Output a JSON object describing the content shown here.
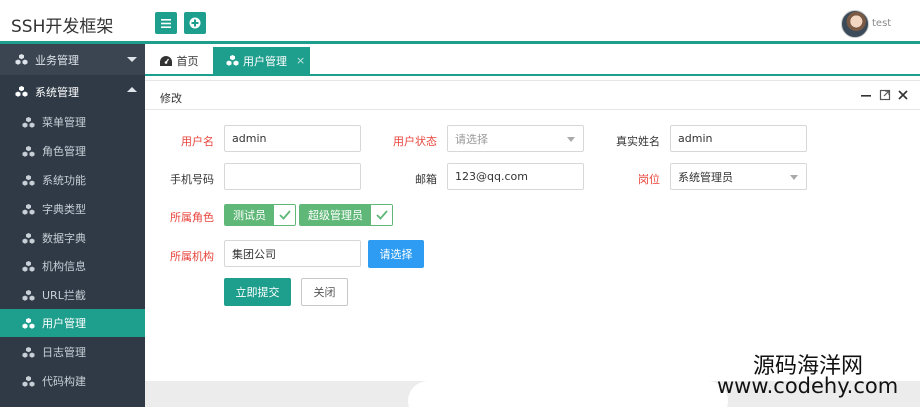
{
  "app": {
    "title": "SSH开发框架",
    "user": "test"
  },
  "header": {
    "menu_icon": "menu-icon",
    "add_icon": "plus-circle-icon"
  },
  "sidebar": {
    "groups": [
      {
        "label": "业务管理",
        "icon": "cubes-icon",
        "expanded": false
      },
      {
        "label": "系统管理",
        "icon": "cubes-icon",
        "expanded": true
      }
    ],
    "items": [
      {
        "label": "菜单管理"
      },
      {
        "label": "角色管理"
      },
      {
        "label": "系统功能"
      },
      {
        "label": "字典类型"
      },
      {
        "label": "数据字典"
      },
      {
        "label": "机构信息"
      },
      {
        "label": "URL拦截"
      },
      {
        "label": "用户管理",
        "active": true
      },
      {
        "label": "日志管理"
      },
      {
        "label": "代码构建"
      }
    ]
  },
  "tabs": [
    {
      "label": "首页",
      "icon": "dashboard-icon"
    },
    {
      "label": "用户管理",
      "icon": "cubes-icon",
      "active": true,
      "close": "×"
    }
  ],
  "panel": {
    "title": "修改"
  },
  "form": {
    "username_label": "用户名",
    "username_value": "admin",
    "status_label": "用户状态",
    "status_placeholder": "请选择",
    "realname_label": "真实姓名",
    "realname_value": "admin",
    "phone_label": "手机号码",
    "phone_value": "",
    "email_label": "邮箱",
    "email_value": "123@qq.com",
    "post_label": "岗位",
    "post_value": "系统管理员",
    "roles_label": "所属角色",
    "roles": [
      {
        "label": "测试员",
        "checked": true
      },
      {
        "label": "超级管理员",
        "checked": true
      }
    ],
    "org_label": "所属机构",
    "org_value": "集团公司",
    "org_button": "请选择",
    "submit": "立即提交",
    "close": "关闭"
  },
  "watermark": {
    "line1": "源码海洋网",
    "line2": "www.codehy.com"
  },
  "colors": {
    "primary": "#1e9e8c",
    "sidebar": "#2f3a46",
    "required": "#e8453c",
    "check": "#5fb878",
    "blue_button": "#2d9cf2"
  }
}
